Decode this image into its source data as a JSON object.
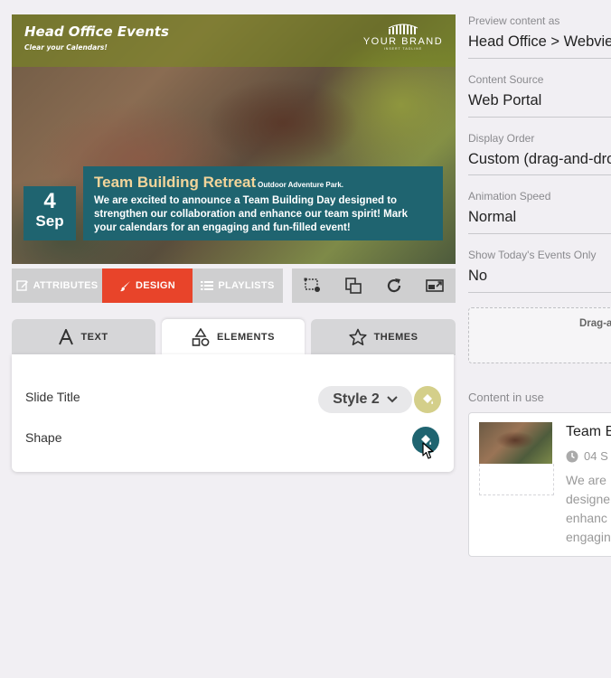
{
  "preview": {
    "event_title": "Head Office Events",
    "event_subtitle": "Clear your Calendars!",
    "brand_name": "YOUR BRAND",
    "brand_tagline": "INSERT TAGLINE",
    "date_day": "4",
    "date_month": "Sep",
    "slide_title": "Team Building Retreat",
    "slide_location": "Outdoor Adventure Park.",
    "slide_description": "We are excited to announce a Team Building Day designed to strengthen our collaboration and enhance our team spirit! Mark your calendars for an engaging and fun-filled event!"
  },
  "toolbar": {
    "tabs": [
      {
        "label": "ATTRIBUTES",
        "icon": "edit-icon"
      },
      {
        "label": "DESIGN",
        "icon": "brush-icon",
        "active": true
      },
      {
        "label": "PLAYLISTS",
        "icon": "list-icon"
      }
    ],
    "tools": [
      "crop-icon",
      "layers-icon",
      "refresh-icon",
      "screen-cast-icon"
    ],
    "active_color": "#e8442a"
  },
  "design_tabs": [
    {
      "label": "TEXT",
      "icon": "text-icon"
    },
    {
      "label": "ELEMENTS",
      "icon": "shapes-icon",
      "active": true
    },
    {
      "label": "THEMES",
      "icon": "star-icon"
    }
  ],
  "elements_panel": {
    "slide_title_label": "Slide Title",
    "style_value": "Style 2",
    "shape_label": "Shape",
    "slide_title_color": "#d4cf8a",
    "shape_color": "#1f6470"
  },
  "settings": {
    "preview_as": {
      "label": "Preview content as",
      "value": "Head Office > Webview"
    },
    "content_source": {
      "label": "Content Source",
      "value": "Web Portal"
    },
    "display_order": {
      "label": "Display Order",
      "value": "Custom (drag-and-drop)"
    },
    "animation_speed": {
      "label": "Animation Speed",
      "value": "Normal"
    },
    "today_only": {
      "label": "Show Today's Events Only",
      "value": "No"
    }
  },
  "dropzone_text": "Drag-a",
  "content_in_use": {
    "label": "Content in use",
    "item_title": "Team B",
    "item_date": "04 S",
    "item_lines": [
      "We are",
      "designe",
      "enhanc",
      "engagin"
    ]
  }
}
